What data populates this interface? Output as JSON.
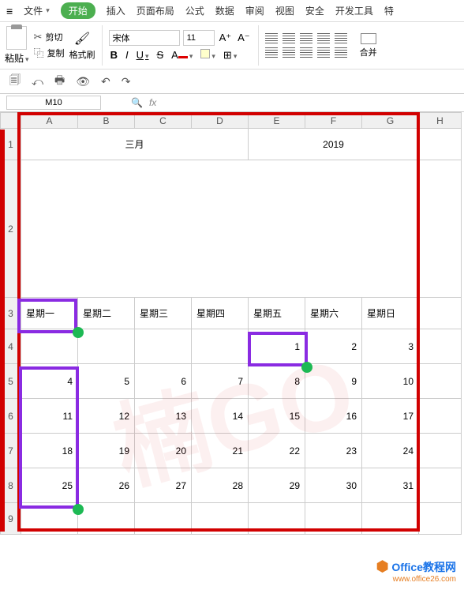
{
  "menu": {
    "file": "文件",
    "start": "开始",
    "insert": "插入",
    "layout": "页面布局",
    "formula": "公式",
    "data": "数据",
    "review": "审阅",
    "view": "视图",
    "security": "安全",
    "dev": "开发工具",
    "special": "特"
  },
  "ribbon": {
    "paste": "粘贴",
    "cut": "剪切",
    "copy": "复制",
    "formatBrush": "格式刷",
    "fontName": "宋体",
    "fontSize": "11",
    "merge": "合并"
  },
  "namebox": "M10",
  "fx": "fx",
  "cols": [
    "A",
    "B",
    "C",
    "D",
    "E",
    "F",
    "G",
    "H"
  ],
  "rows": [
    "1",
    "2",
    "3",
    "4",
    "5",
    "6",
    "7",
    "8",
    "9"
  ],
  "sheet": {
    "month": "三月",
    "year": "2019",
    "days": [
      "星期一",
      "星期二",
      "星期三",
      "星期四",
      "星期五",
      "星期六",
      "星期日"
    ],
    "r4": [
      "",
      "",
      "",
      "",
      "1",
      "2",
      "3"
    ],
    "r5": [
      "4",
      "5",
      "6",
      "7",
      "8",
      "9",
      "10"
    ],
    "r6": [
      "11",
      "12",
      "13",
      "14",
      "15",
      "16",
      "17"
    ],
    "r7": [
      "18",
      "19",
      "20",
      "21",
      "22",
      "23",
      "24"
    ],
    "r8": [
      "25",
      "26",
      "27",
      "28",
      "29",
      "30",
      "31"
    ]
  },
  "footer": {
    "brand": "Office教程网",
    "url": "www.office26.com"
  }
}
